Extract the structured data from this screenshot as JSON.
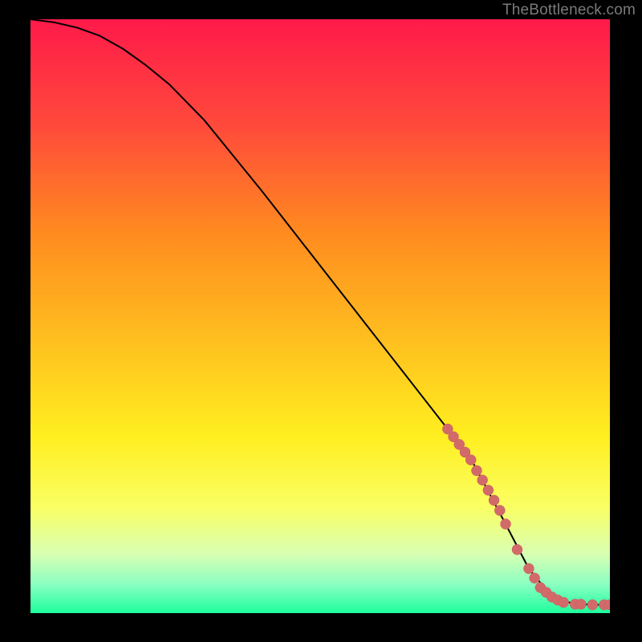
{
  "watermark": {
    "text": "TheBottleneck.com"
  },
  "gradient": {
    "stops": [
      {
        "pct": 0,
        "color": "#ff1a4a"
      },
      {
        "pct": 18,
        "color": "#ff4a3b"
      },
      {
        "pct": 36,
        "color": "#ff8b1f"
      },
      {
        "pct": 55,
        "color": "#ffc21f"
      },
      {
        "pct": 70,
        "color": "#ffee1f"
      },
      {
        "pct": 82,
        "color": "#faff62"
      },
      {
        "pct": 90,
        "color": "#d9ffb3"
      },
      {
        "pct": 95,
        "color": "#8dffc2"
      },
      {
        "pct": 100,
        "color": "#1dff9e"
      }
    ]
  },
  "colors": {
    "curve_stroke": "#000000",
    "dot_fill": "#d26a6a",
    "dot_stroke": "#c95a5a"
  },
  "chart_data": {
    "type": "line",
    "title": "",
    "xlabel": "",
    "ylabel": "",
    "xlim": [
      0,
      100
    ],
    "ylim": [
      0,
      100
    ],
    "grid": false,
    "series": [
      {
        "name": "curve",
        "x": [
          0,
          4,
          8,
          12,
          16,
          20,
          24,
          30,
          40,
          50,
          60,
          70,
          76,
          82,
          86,
          90,
          94,
          98,
          100
        ],
        "y": [
          100,
          99.5,
          98.6,
          97.2,
          95.0,
          92.2,
          89.0,
          83.0,
          71.0,
          58.5,
          46.0,
          33.5,
          26.0,
          15.0,
          7.5,
          2.7,
          1.5,
          1.4,
          1.4
        ]
      },
      {
        "name": "dots",
        "x": [
          72,
          73,
          74,
          75,
          76,
          77,
          78,
          79,
          80,
          81,
          82,
          84,
          86,
          87,
          88,
          89,
          90,
          91,
          92,
          94,
          95,
          97,
          99,
          100
        ],
        "y": [
          31,
          29.7,
          28.4,
          27.1,
          25.8,
          24.0,
          22.4,
          20.7,
          19.0,
          17.3,
          15.0,
          10.7,
          7.5,
          5.9,
          4.3,
          3.5,
          2.7,
          2.2,
          1.8,
          1.5,
          1.5,
          1.4,
          1.4,
          1.4
        ]
      }
    ]
  }
}
